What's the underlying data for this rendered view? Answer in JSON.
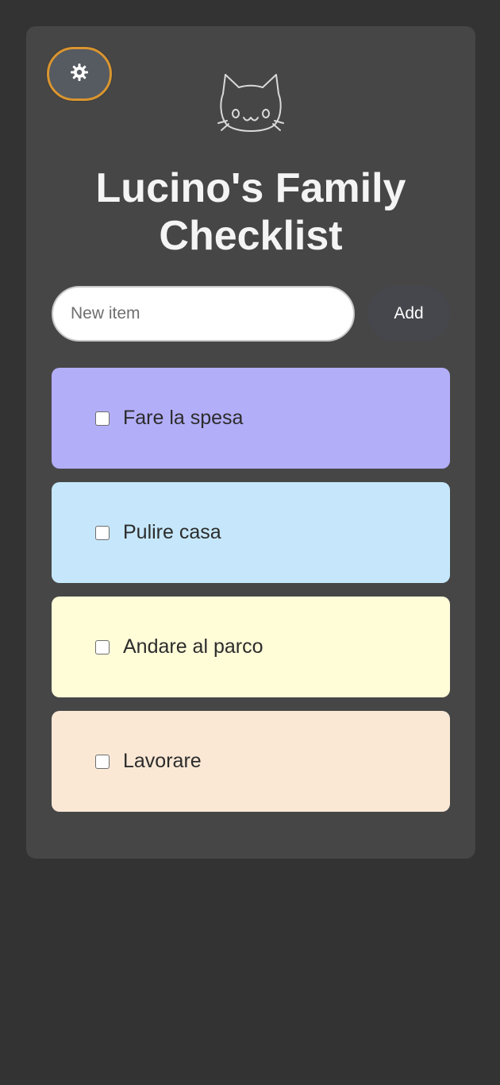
{
  "app": {
    "title": "Lucino's Family Checklist",
    "logo_icon": "cat-face-icon",
    "theme_toggle_icon": "gear-icon"
  },
  "colors": {
    "page_background": "#333333",
    "card_background": "#464646",
    "toggle_border": "#d9952f",
    "add_button_background": "#45474c"
  },
  "form": {
    "input_value": "",
    "input_placeholder": "New item",
    "add_label": "Add"
  },
  "items": [
    {
      "label": "Fare la spesa",
      "checked": false,
      "color": "#b3aef8"
    },
    {
      "label": "Pulire casa",
      "checked": false,
      "color": "#c6e7fb"
    },
    {
      "label": "Andare al parco",
      "checked": false,
      "color": "#fffcd8"
    },
    {
      "label": "Lavorare",
      "checked": false,
      "color": "#fae8d5"
    }
  ]
}
